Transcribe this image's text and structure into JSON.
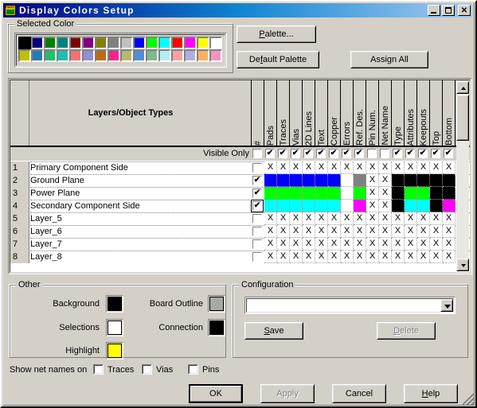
{
  "window": {
    "title": "Display Colors Setup",
    "icon": "pads-app-icon",
    "buttons": {
      "minimize": "_",
      "maximize": "□",
      "close": "✕"
    }
  },
  "selected_color": {
    "legend": "Selected Color",
    "row1": [
      "#000000",
      "#000080",
      "#008000",
      "#008080",
      "#800000",
      "#800080",
      "#808000",
      "#808080",
      "#c0c0c0",
      "#0000ff",
      "#00ff00",
      "#00ffff",
      "#ff0000",
      "#ff00ff",
      "#ffff00",
      "#ffffff"
    ],
    "row2": [
      "#c0c000",
      "#1f7cc0",
      "#22c06a",
      "#1fc0b0",
      "#ff6e6e",
      "#9090d8",
      "#c06a10",
      "#ff1f8f",
      "#b8b86e",
      "#4a90e2",
      "#80b890",
      "#b0f0f0",
      "#ffa0a0",
      "#b0b0e0",
      "#ffb060",
      "#ff90c0"
    ],
    "selected_index": 0
  },
  "actions": {
    "palette": "Palette...",
    "default_palette": "Default Palette",
    "assign_all": "Assign All"
  },
  "table": {
    "header_label": "Layers/Object Types",
    "columns": [
      "#",
      "Pads",
      "Traces",
      "Vias",
      "2D Lines",
      "Text",
      "Copper",
      "Errors",
      "Ref. Des.",
      "Pin Num.",
      "Net Name",
      "Type",
      "Attributes",
      "Keepouts",
      "Top",
      "Bottom"
    ],
    "visible_only_label": "Visible Only",
    "visible_only": [
      false,
      true,
      true,
      true,
      true,
      true,
      true,
      true,
      true,
      false,
      false,
      true,
      true,
      true,
      true,
      true
    ],
    "rows": [
      {
        "num": "1",
        "name": "Primary Component Side",
        "checked": false,
        "cells": [
          "x",
          "x",
          "x",
          "x",
          "x",
          "x",
          "x",
          "x",
          "x",
          "x",
          "x",
          "x",
          "x",
          "x",
          "x"
        ]
      },
      {
        "num": "2",
        "name": "Ground Plane",
        "checked": true,
        "cells": [
          "#0000ff",
          "#0000ff",
          "#0000ff",
          "#0000ff",
          "#0000ff",
          "#0000ff",
          "#ffffff",
          "#808080",
          "x",
          "x",
          "#000000",
          "#000000",
          "#000000",
          "#000000",
          "#000000"
        ]
      },
      {
        "num": "3",
        "name": "Power Plane",
        "checked": true,
        "cells": [
          "#00ff00",
          "#00ff00",
          "#00ff00",
          "#00ff00",
          "#00ff00",
          "#00ff00",
          "#ffffff",
          "#00ff00",
          "x",
          "x",
          "#000000",
          "#00ff00",
          "#00ff00",
          "#000000",
          "#000000"
        ]
      },
      {
        "num": "4",
        "name": "Secondary Component Side",
        "checked": true,
        "focused": true,
        "cells": [
          "#00ffff",
          "#00ffff",
          "#00ffff",
          "#00ffff",
          "#00ffff",
          "#00ffff",
          "#ffffff",
          "#ff00ff",
          "x",
          "x",
          "#000000",
          "#00ffff",
          "#00ffff",
          "#000000",
          "#ff00ff"
        ]
      },
      {
        "num": "5",
        "name": "Layer_5",
        "checked": false,
        "cells": [
          "x",
          "x",
          "x",
          "x",
          "x",
          "x",
          "x",
          "x",
          "x",
          "x",
          "x",
          "x",
          "x",
          "x",
          "x"
        ]
      },
      {
        "num": "6",
        "name": "Layer_6",
        "checked": false,
        "cells": [
          "x",
          "x",
          "x",
          "x",
          "x",
          "x",
          "x",
          "x",
          "x",
          "x",
          "x",
          "x",
          "x",
          "x",
          "x"
        ]
      },
      {
        "num": "7",
        "name": "Layer_7",
        "checked": false,
        "cells": [
          "x",
          "x",
          "x",
          "x",
          "x",
          "x",
          "x",
          "x",
          "x",
          "x",
          "x",
          "x",
          "x",
          "x",
          "x"
        ]
      },
      {
        "num": "8",
        "name": "Layer_8",
        "checked": false,
        "cells": [
          "x",
          "x",
          "x",
          "x",
          "x",
          "x",
          "x",
          "x",
          "x",
          "x",
          "x",
          "x",
          "x",
          "x",
          "x"
        ]
      }
    ],
    "x_glyph": "X"
  },
  "other": {
    "legend": "Other",
    "background_label": "Background",
    "background_color": "#000000",
    "selections_label": "Selections",
    "selections_color": "#ffffff",
    "highlight_label": "Highlight",
    "highlight_color": "#ffff00",
    "board_outline_label": "Board Outline",
    "board_outline_color": "#a8a8a8",
    "connection_label": "Connection",
    "connection_color": "#000000"
  },
  "configuration": {
    "legend": "Configuration",
    "value": "",
    "save": "Save",
    "delete": "Delete"
  },
  "net_names": {
    "label": "Show net names on",
    "traces": "Traces",
    "vias": "Vias",
    "pins": "Pins",
    "traces_checked": false,
    "vias_checked": false,
    "pins_checked": false
  },
  "footer": {
    "ok": "OK",
    "apply": "Apply",
    "cancel": "Cancel",
    "help": "Help"
  }
}
